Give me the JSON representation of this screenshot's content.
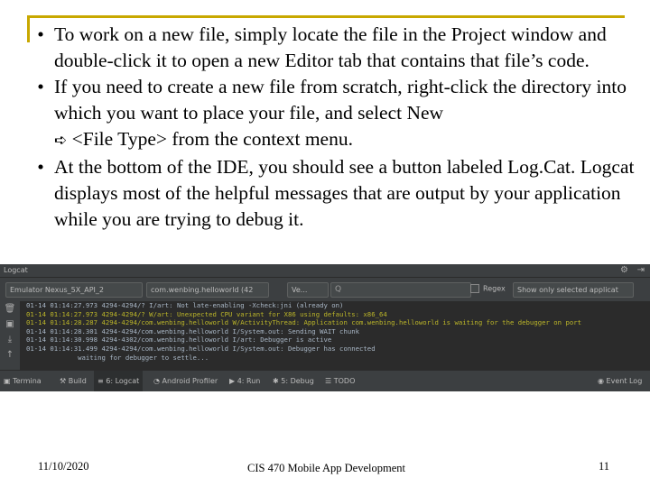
{
  "slide": {
    "bullets": [
      {
        "marker": "•",
        "text": "To work on a new file, simply locate the file in the Project window and double-click it to open a new Editor tab that contains that file’s code."
      },
      {
        "marker": "•",
        "text_before": "If you need to create a new file from scratch, right-click the directory into which you want to place your file, and select New",
        "arrow": "➪",
        "text_after": "<File Type> from the context menu."
      },
      {
        "marker": "•",
        "text": "At the bottom of the IDE, you should see a button labeled Log.Cat. Logcat displays most of the helpful messages that are output by your application while you are trying to debug it."
      }
    ]
  },
  "ide": {
    "panel_title": "Logcat",
    "gear_icon": "⚙",
    "hide_icon": "⇥",
    "device_combo": "Emulator Nexus_5X_API_2",
    "process_combo": "com.wenbing.helloworld (42",
    "level_combo": "Ve...",
    "search_placeholder": "Q",
    "regex_label": "Regex",
    "filter_combo": "Show only selected applicat",
    "left_tool_icons": [
      "🗑",
      "▣",
      "⤓",
      "↑",
      "…"
    ],
    "log_lines": [
      {
        "text": "01-14 01:14:27.973 4294-4294/? I/art: Not late-enabling -Xcheck:jni (already on)",
        "level": "info"
      },
      {
        "text": "01-14 01:14:27.973 4294-4294/? W/art: Unexpected CPU variant for X86 using defaults: x86_64",
        "level": "warn"
      },
      {
        "text": "01-14 01:14:28.287 4294-4294/com.wenbing.helloworld W/ActivityThread: Application com.wenbing.helloworld is waiting for the debugger on port",
        "level": "warn"
      },
      {
        "text": "01-14 01:14:28.301 4294-4294/com.wenbing.helloworld I/System.out: Sending WAIT chunk",
        "level": "info"
      },
      {
        "text": "01-14 01:14:30.998 4294-4302/com.wenbing.helloworld I/art: Debugger is active",
        "level": "info"
      },
      {
        "text": "01-14 01:14:31.499 4294-4294/com.wenbing.helloworld I/System.out: Debugger has connected",
        "level": "info"
      },
      {
        "text": "             waiting for debugger to settle...",
        "level": "info"
      }
    ],
    "tool_windows": [
      {
        "label": "Termina",
        "icon": "▣"
      },
      {
        "label": "Build",
        "icon": "⚒"
      },
      {
        "label": "6: Logcat",
        "icon": "≡"
      },
      {
        "label": "Android Profiler",
        "icon": "◔"
      },
      {
        "label": "4: Run",
        "icon": "▶"
      },
      {
        "label": "5: Debug",
        "icon": "✱"
      },
      {
        "label": "TODO",
        "icon": "☰"
      },
      {
        "label": "Event Log",
        "icon": "◉"
      }
    ]
  },
  "footer": {
    "date": "11/10/2020",
    "course": "CIS 470 Mobile App Development",
    "page": "11"
  },
  "colors": {
    "frame_accent": "#c8a800",
    "ide_background": "#3c3f41",
    "log_background": "#2b2b2b",
    "log_text": "#a9b7c6",
    "log_warning": "#bbb529"
  }
}
